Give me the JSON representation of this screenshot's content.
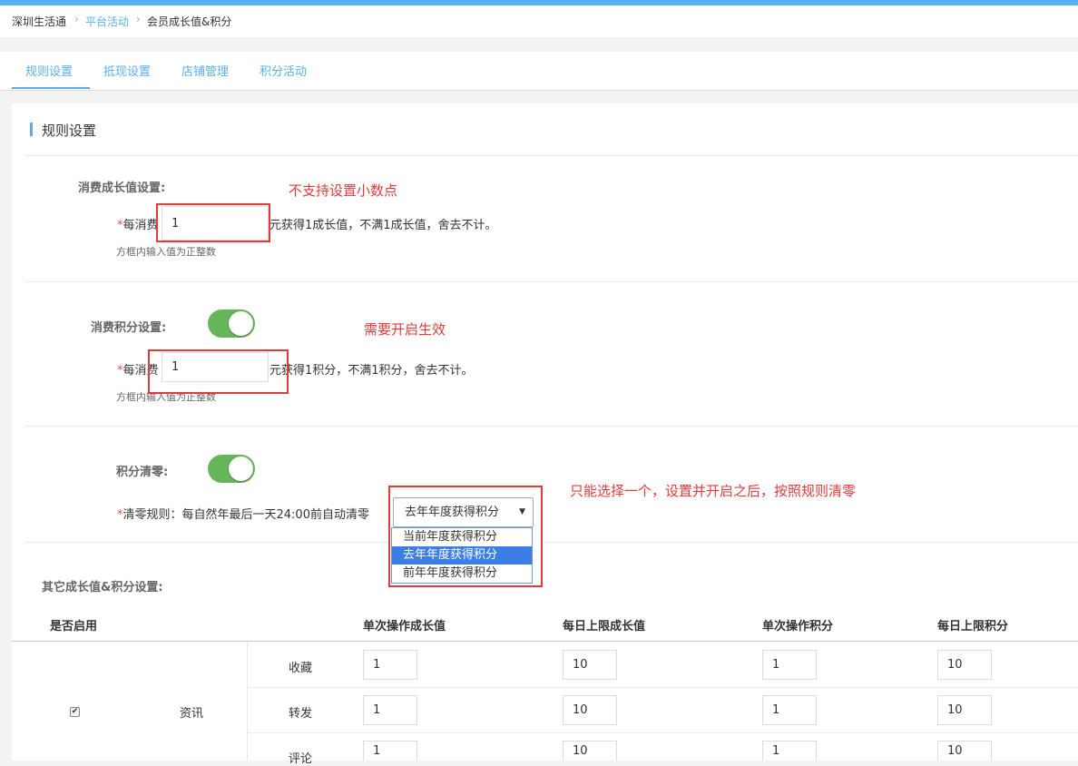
{
  "breadcrumb": {
    "root": "深圳生活通",
    "section": "平台活动",
    "current": "会员成长值&积分",
    "separator": "›"
  },
  "tabs": [
    "规则设置",
    "抵现设置",
    "店铺管理",
    "积分活动"
  ],
  "section_title": "规则设置",
  "growth": {
    "label": "消费成长值设置:",
    "prefix": "每消费",
    "value": "1",
    "suffix": "元获得1成长值，不满1成长值，舍去不计。",
    "hint": "方框内输入值为正整数",
    "annotation": "不支持设置小数点"
  },
  "points": {
    "label": "消费积分设置:",
    "enabled": true,
    "prefix": "每消费",
    "value": "1",
    "suffix": "元获得1积分，不满1积分，舍去不计。",
    "hint": "方框内输入值为正整数",
    "annotation": "需要开启生效"
  },
  "clear": {
    "label": "积分清零:",
    "enabled": true,
    "rule_text": "清零规则：每自然年最后一天24:00前自动清零",
    "selected": "去年年度获得积分",
    "options": [
      "当前年度获得积分",
      "去年年度获得积分",
      "前年年度获得积分"
    ],
    "annotation": "只能选择一个，设置并开启之后，按照规则清零"
  },
  "other": {
    "label": "其它成长值&积分设置:",
    "headers": [
      "是否启用",
      "单次操作成长值",
      "每日上限成长值",
      "单次操作积分",
      "每日上限积分"
    ],
    "group": "资讯",
    "group_checked": true,
    "rows": [
      {
        "name": "收藏",
        "values": [
          "1",
          "10",
          "1",
          "10"
        ]
      },
      {
        "name": "转发",
        "values": [
          "1",
          "10",
          "1",
          "10"
        ]
      },
      {
        "name": "评论",
        "values": [
          "1",
          "10",
          "1",
          "10"
        ]
      }
    ]
  },
  "colors": {
    "accent": "#5aaef0",
    "annotation_red": "#e03c3c",
    "toggle_on": "#67b55a",
    "selected_option": "#3d7ee6"
  }
}
